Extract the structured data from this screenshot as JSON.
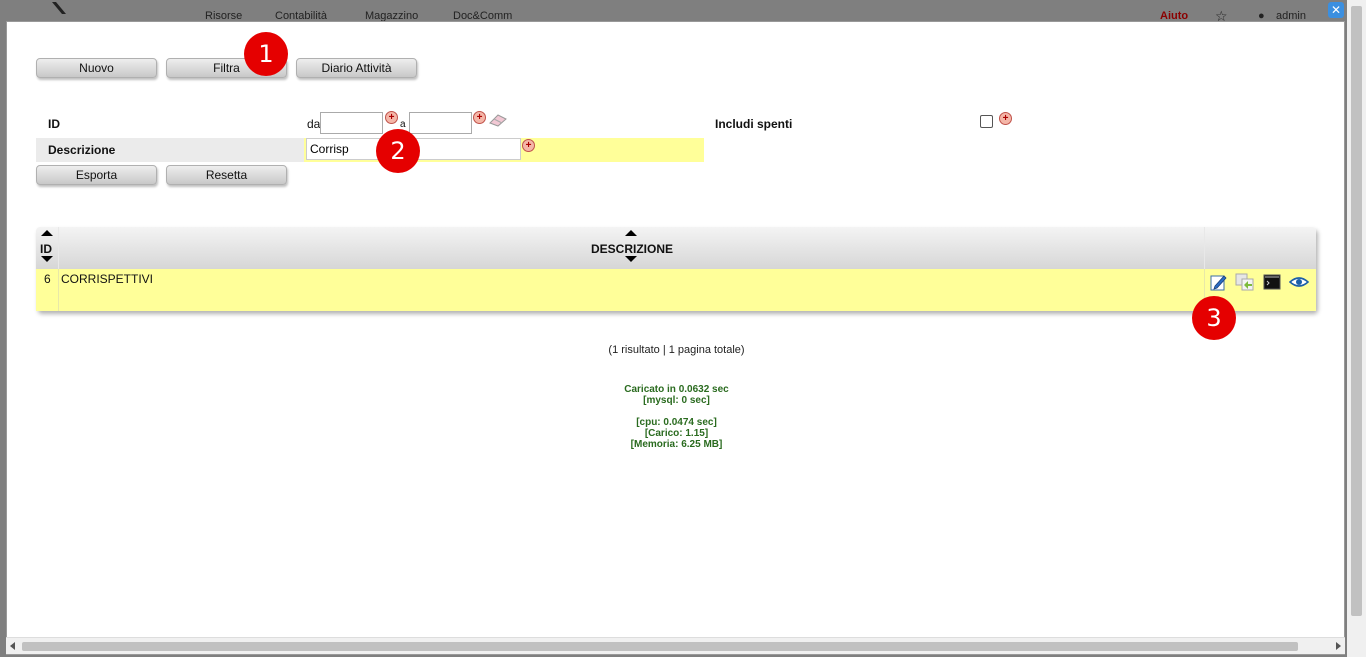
{
  "bg_nav": {
    "items": [
      "Risorse",
      "Contabilità",
      "Magazzino",
      "Doc&Comm"
    ],
    "help": "Aiuto",
    "user": "admin"
  },
  "toolbar": {
    "new_label": "Nuovo",
    "filter_label": "Filtra",
    "activity_label": "Diario Attività"
  },
  "filters": {
    "id_label": "ID",
    "from_label": "da",
    "to_label": "a",
    "from_value": "",
    "to_value": "",
    "description_label": "Descrizione",
    "description_value": "Corrisp",
    "include_off_label": "Includi spenti",
    "export_label": "Esporta",
    "reset_label": "Resetta"
  },
  "table": {
    "columns": [
      "ID",
      "DESCRIZIONE"
    ],
    "rows": [
      {
        "id": "6",
        "descrizione": "CORRISPETTIVI"
      }
    ]
  },
  "pager": "(1 risultato | 1 pagina totale)",
  "stats": {
    "loaded": "Caricato in 0.0632 sec",
    "mysql": "[mysql: 0 sec]",
    "cpu": "[cpu: 0.0474 sec]",
    "load": "[Carico: 1.15]",
    "memory": "[Memoria: 6.25 MB]"
  },
  "callouts": [
    "1",
    "2",
    "3"
  ],
  "colors": {
    "highlight_yellow": "#ffff99",
    "callout_red": "#e50000",
    "stats_green": "#2a6b1f"
  }
}
